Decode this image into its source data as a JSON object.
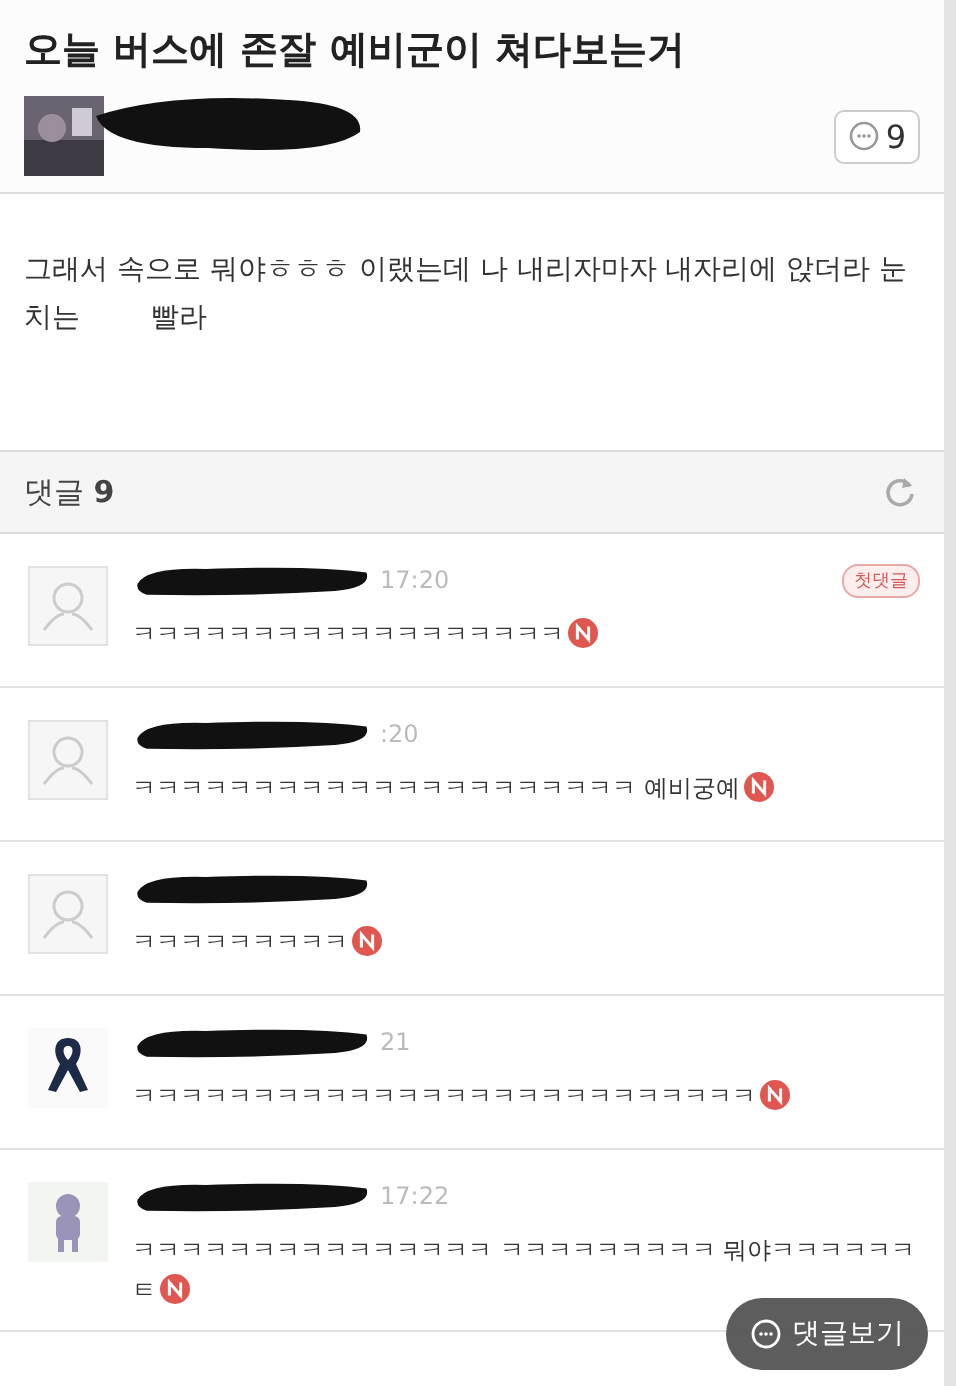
{
  "post": {
    "title": "오늘 버스에 존잘 예비군이 쳐다보는거",
    "comment_count": "9",
    "body": "그래서 속으로 뭐야ㅎㅎㅎ 이랬는데 나 내리자마자 내자리에 앉더라 눈치는        빨라"
  },
  "comments_header": {
    "label": "댓글",
    "count": "9"
  },
  "comments": [
    {
      "kind": "default",
      "time": "17:20",
      "badge": "첫댓글",
      "text": "ㅋㅋㅋㅋㅋㅋㅋㅋㅋㅋㅋㅋㅋㅋㅋㅋㅋㅋ",
      "new": true
    },
    {
      "kind": "default",
      "time": ":20",
      "text": "ㅋㅋㅋㅋㅋㅋㅋㅋㅋㅋㅋㅋㅋㅋㅋㅋㅋㅋㅋㅋㅋ 예비궁예",
      "new": true
    },
    {
      "kind": "default",
      "text": "ㅋㅋㅋㅋㅋㅋㅋㅋㅋ",
      "new": true
    },
    {
      "kind": "ribbon",
      "time": "21",
      "text": "ㅋㅋㅋㅋㅋㅋㅋㅋㅋㅋㅋㅋㅋㅋㅋㅋㅋㅋㅋㅋㅋㅋㅋㅋㅋㅋ",
      "new": true
    },
    {
      "kind": "figure",
      "time": "17:22",
      "text": "ㅋㅋㅋㅋㅋㅋㅋㅋㅋㅋㅋㅋㅋㅋㅋ        ㅋㅋㅋㅋㅋㅋㅋㅋㅋ 뭐야ㅋㅋㅋㅋㅋㅋㅌ",
      "new": true
    }
  ],
  "floating_button": {
    "label": "댓글보기"
  }
}
